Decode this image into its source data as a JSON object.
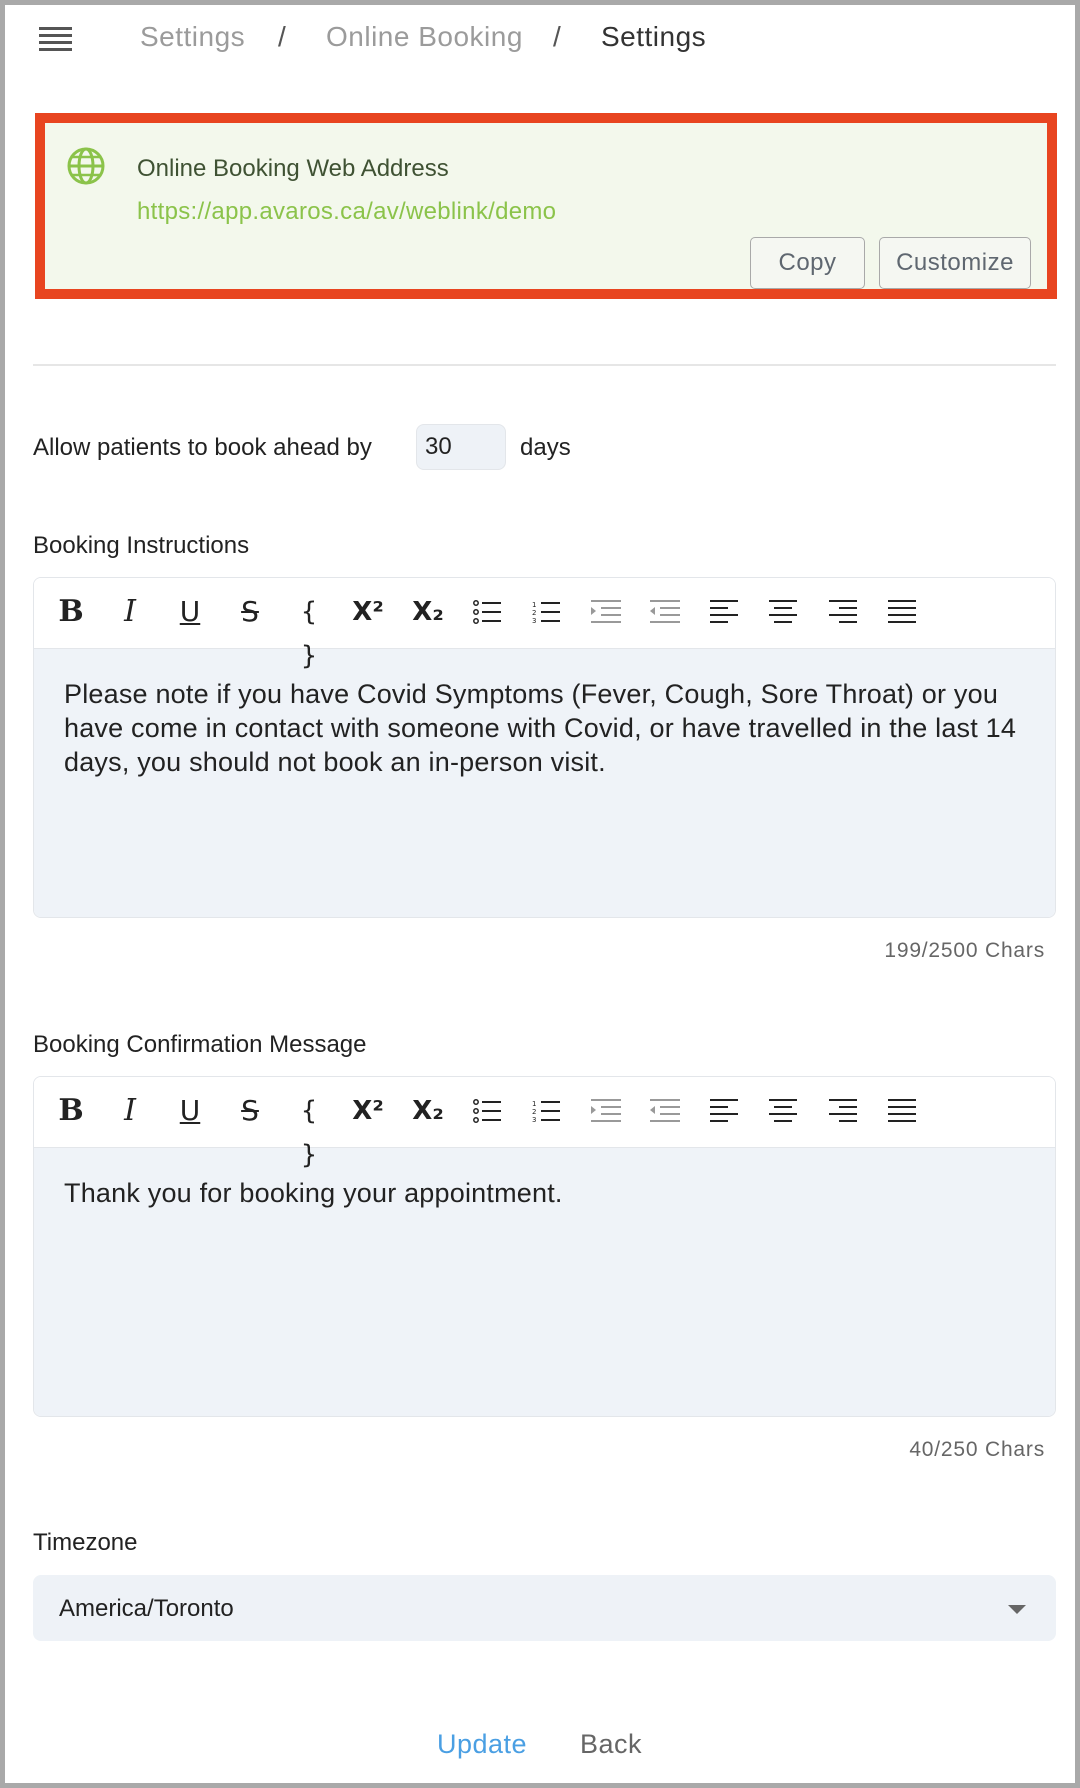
{
  "breadcrumb": {
    "items": [
      "Settings",
      "Online Booking",
      "Settings"
    ],
    "separator": "/"
  },
  "web_address": {
    "title": "Online Booking Web Address",
    "url": "https://app.avaros.ca/av/weblink/demo",
    "copy_label": "Copy",
    "customize_label": "Customize"
  },
  "book_ahead": {
    "label": "Allow patients to book ahead by",
    "value": "30",
    "unit": "days"
  },
  "booking_instructions": {
    "label": "Booking Instructions",
    "text": "Please note if you have Covid Symptoms (Fever, Cough, Sore Throat) or you have come in contact with someone with Covid, or have travelled in the last 14 days, you should not book an in-person visit.",
    "counter": "199/2500 Chars"
  },
  "booking_confirmation": {
    "label": "Booking Confirmation Message",
    "text": "Thank you for booking your appointment.",
    "counter": "40/250 Chars"
  },
  "timezone": {
    "label": "Timezone",
    "value": "America/Toronto"
  },
  "actions": {
    "update_label": "Update",
    "back_label": "Back"
  },
  "toolbar": {
    "bold": "B",
    "italic": "I",
    "underline": "U",
    "strike": "S",
    "code": "{ }",
    "superscript": "X²",
    "subscript": "X₂"
  },
  "colors": {
    "highlight_border": "#e84520",
    "address_bg": "#f3f8ec",
    "url": "#8bc34a",
    "update": "#4a9fe3"
  }
}
